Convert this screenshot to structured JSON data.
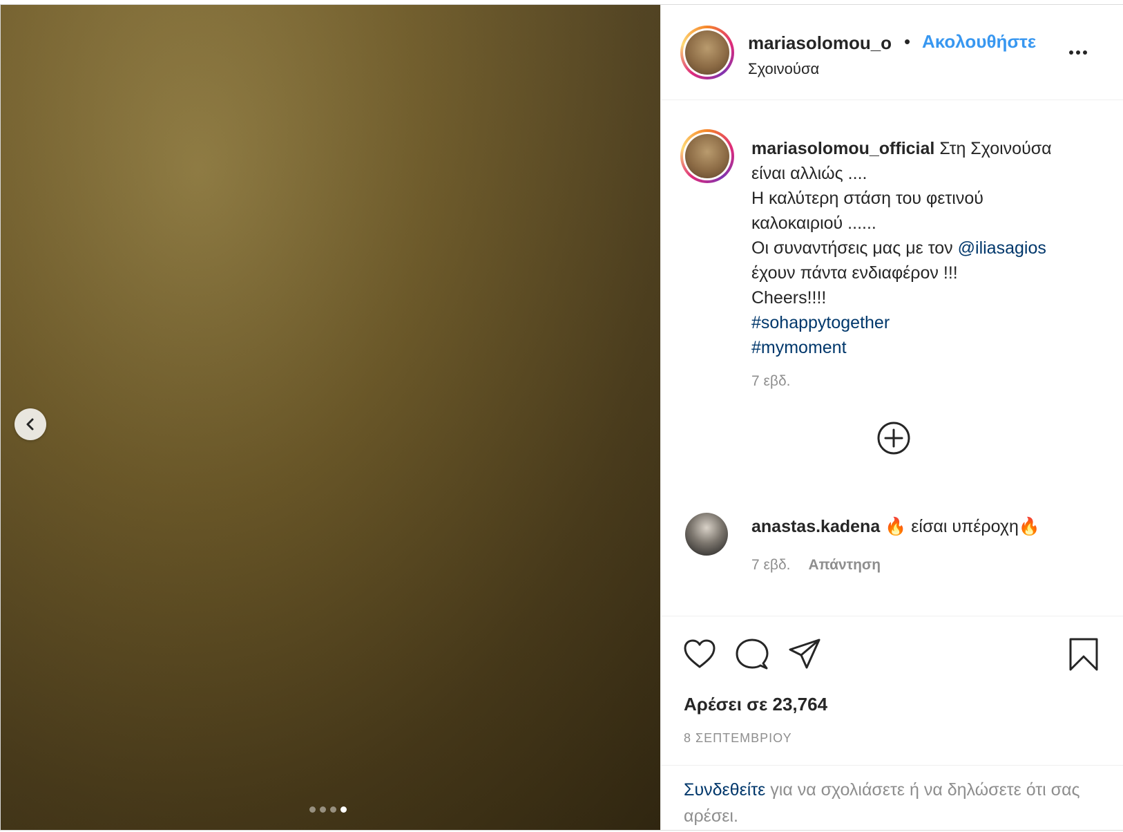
{
  "header": {
    "username": "mariasolomou_o",
    "separator": "•",
    "follow_label": "Ακολουθήστε",
    "location": "Σχοινούσα"
  },
  "caption": {
    "username": "mariasolomou_official",
    "line1": "Στη Σχοινούσα",
    "line2": "είναι αλλιώς ....",
    "line3": "Η καλύτερη στάση του φετινού",
    "line4": "καλοκαιριού ......",
    "line5_prefix": "Οι συναντήσεις μας με τον",
    "mention": "@iliasagios",
    "line6": "έχουν πάντα ενδιαφέρον !!!",
    "line7": "Cheers!!!!",
    "hashtag1": "#sohappytogether",
    "hashtag2": "#mymoment",
    "time": "7 εβδ."
  },
  "comment": {
    "username": "anastas.kadena",
    "text": "🔥 είσαι υπέροχη🔥",
    "time": "7 εβδ.",
    "reply_label": "Απάντηση"
  },
  "actions": {
    "icons": [
      "heart-icon",
      "comment-icon",
      "share-icon",
      "bookmark-icon"
    ]
  },
  "likes": "Αρέσει σε 23,764",
  "date": "8 ΣΕΠΤΕΜΒΡΙΟΥ",
  "login": {
    "link": "Συνδεθείτε",
    "text": "για να σχολιάσετε ή να δηλώσετε ότι σας αρέσει."
  },
  "carousel": {
    "count": 4,
    "active_index": 3
  },
  "colors": {
    "link_blue": "#3897f0",
    "dark_link": "#00376b",
    "muted": "#8e8e8e",
    "text": "#262626"
  }
}
